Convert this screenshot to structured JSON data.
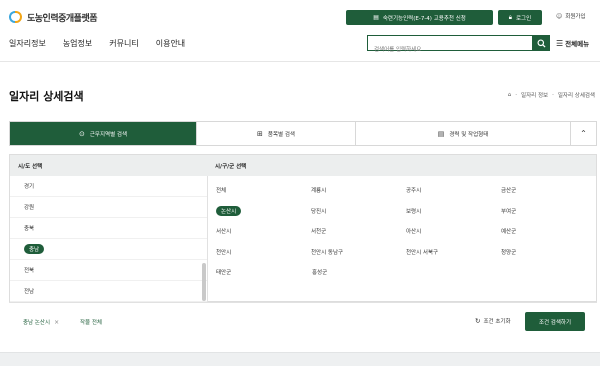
{
  "header": {
    "logo_text": "도농인력중개플랫폼",
    "apply_button": "숙련기능인력(E-7-4) 고용추천 신청",
    "login_button": "로그인",
    "signup_link": "회원가입",
    "nav": [
      "일자리정보",
      "농업정보",
      "커뮤니티",
      "이용안내"
    ],
    "search_placeholder": "검색어를 입력하세요",
    "all_menu": "전체메뉴"
  },
  "page": {
    "title": "일자리 상세검색",
    "breadcrumb": [
      "일자리 정보",
      "일자리 상세검색"
    ]
  },
  "tabs": [
    {
      "label": "근무지역별 검색",
      "icon": "location-pin-icon",
      "active": true
    },
    {
      "label": "품목별 검색",
      "icon": "grid-icon",
      "active": false
    },
    {
      "label": "경력 및 작업형태",
      "icon": "document-icon",
      "active": false
    }
  ],
  "panel": {
    "province_header": "시/도 선택",
    "district_header": "시/구/군 선택",
    "provinces": [
      "경기",
      "강원",
      "충북",
      "충남",
      "전북",
      "전남"
    ],
    "selected_province": "충남",
    "districts": [
      [
        "전체",
        "계룡시",
        "공주시",
        "금산군"
      ],
      [
        "논산시",
        "당진시",
        "보령시",
        "부여군"
      ],
      [
        "서산시",
        "서천군",
        "아산시",
        "예산군"
      ],
      [
        "천안시",
        "천안시 동남구",
        "천안시 서북구",
        "청양군"
      ],
      [
        "태안군",
        "홍성군"
      ]
    ],
    "selected_district": "논산시"
  },
  "selection": {
    "chips": [
      "충남 논산시",
      "작물 전체"
    ],
    "reset_label": "조건 초기화",
    "search_button": "조건 검색하기"
  },
  "colors": {
    "brand_green": "#1f5d3a"
  }
}
